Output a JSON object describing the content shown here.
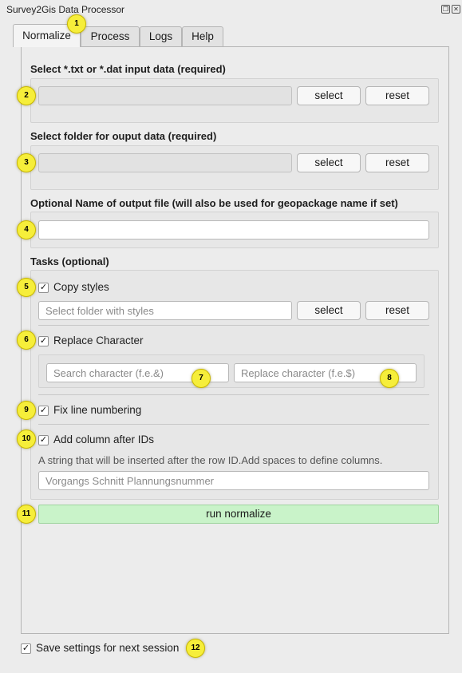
{
  "window": {
    "title": "Survey2Gis Data Processor",
    "restore_icon": "restore-icon",
    "close_icon": "close-icon"
  },
  "tabs": [
    {
      "label": "Normalize",
      "active": true
    },
    {
      "label": "Process",
      "active": false
    },
    {
      "label": "Logs",
      "active": false
    },
    {
      "label": "Help",
      "active": false
    }
  ],
  "input_section": {
    "label": "Select *.txt or *.dat input data (required)",
    "value": "",
    "select_label": "select",
    "reset_label": "reset"
  },
  "output_section": {
    "label": "Select folder for ouput data (required)",
    "value": "",
    "select_label": "select",
    "reset_label": "reset"
  },
  "name_section": {
    "label": "Optional Name of output file (will also be used for geopackage name if set)",
    "value": ""
  },
  "tasks": {
    "label": "Tasks (optional)",
    "copy_styles": {
      "label": "Copy styles",
      "checked": true,
      "placeholder": "Select folder with styles",
      "select_label": "select",
      "reset_label": "reset"
    },
    "replace_character": {
      "label": "Replace Character",
      "checked": true,
      "search_placeholder": "Search character (f.e.&)",
      "replace_placeholder": "Replace character (f.e.$)"
    },
    "fix_line_numbering": {
      "label": "Fix line numbering",
      "checked": true
    },
    "add_column": {
      "label": "Add column after IDs",
      "checked": true,
      "hint": "A string that will be inserted after the row ID.Add spaces to define columns.",
      "placeholder": "Vorgangs Schnitt Plannungsnummer"
    }
  },
  "run_label": "run normalize",
  "save_settings": {
    "label": "Save settings for next session",
    "checked": true
  },
  "check_mark": "✓",
  "markers": [
    "1",
    "2",
    "3",
    "4",
    "5",
    "6",
    "7",
    "8",
    "9",
    "10",
    "11",
    "12"
  ],
  "colors": {
    "marker": "#f6ee3a",
    "run_button": "#c9f3c9",
    "panel": "#ececec"
  }
}
